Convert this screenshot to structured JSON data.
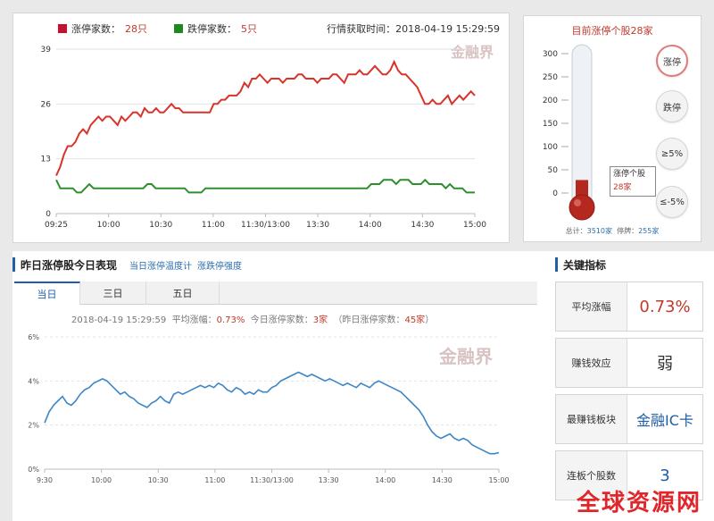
{
  "top_panel": {
    "legend_limit_up_label": "涨停家数：",
    "legend_limit_up_value": "28只",
    "legend_limit_down_label": "跌停家数：",
    "legend_limit_down_value": "5只",
    "timestamp": "行情获取时间：2018-04-19 15:29:59",
    "watermark": "金融界"
  },
  "thermometer": {
    "title": "目前涨停个股28家",
    "tooltip_line1": "涨停个股",
    "tooltip_line2": "28家",
    "footer_total_label": "总计：",
    "footer_total_value": "3510家",
    "footer_suspended_label": "停牌：",
    "footer_suspended_value": "255家",
    "buttons": [
      "涨停",
      "跌停",
      "≥5%",
      "≤-5%"
    ],
    "active_button": "涨停",
    "current_value": 28
  },
  "bottom_section": {
    "title": "昨日涨停股今日表现",
    "link1": "当日涨停温度计",
    "link2": "涨跌停强度",
    "tabs": [
      "当日",
      "三日",
      "五日"
    ],
    "active_tab": "当日",
    "stats_time": "2018-04-19 15:29:59",
    "stats_avg_label": "平均涨幅：",
    "stats_avg_value": "0.73%",
    "stats_today_label": "今日涨停家数：",
    "stats_today_value": "3家",
    "stats_yesterday_label": "（昨日涨停家数：",
    "stats_yesterday_value": "45家",
    "stats_close": "）",
    "watermark": "金融界"
  },
  "key_indicators": {
    "title": "关键指标",
    "items": [
      {
        "label": "平均涨幅",
        "value": "0.73%"
      },
      {
        "label": "赚钱效应",
        "value": "弱"
      },
      {
        "label": "最赚钱板块",
        "value": "金融IC卡"
      },
      {
        "label": "连板个股数",
        "value": "3"
      }
    ]
  },
  "site_watermark": "全球资源网",
  "colors": {
    "up": "#d9342b",
    "down": "#2f8f2f",
    "line": "#3d86c6",
    "accent": "#1f5fa8"
  },
  "chart_data": [
    {
      "type": "line",
      "x_ticks": [
        "09:25",
        "10:00",
        "10:30",
        "11:00",
        "11:30/13:00",
        "13:30",
        "14:00",
        "14:30",
        "15:00"
      ],
      "y_ticks": [
        "0",
        "13",
        "26",
        "39"
      ],
      "ylim": [
        0,
        39
      ],
      "grid": true,
      "series": [
        {
          "name": "涨停家数",
          "color": "#d9342b",
          "values": [
            9,
            11,
            14,
            16,
            16,
            17,
            19,
            20,
            19,
            21,
            22,
            23,
            22,
            23,
            23,
            22,
            21,
            23,
            22,
            23,
            24,
            24,
            23,
            25,
            24,
            24,
            25,
            24,
            24,
            25,
            26,
            25,
            25,
            24,
            24,
            24,
            24,
            24,
            24,
            24,
            24,
            26,
            26,
            27,
            27,
            28,
            28,
            28,
            29,
            31,
            30,
            32,
            32,
            33,
            32,
            31,
            32,
            32,
            32,
            31,
            32,
            32,
            32,
            33,
            33,
            32,
            32,
            32,
            31,
            32,
            32,
            32,
            33,
            33,
            32,
            31,
            33,
            33,
            33,
            34,
            33,
            33,
            34,
            35,
            34,
            33,
            33,
            34,
            36,
            34,
            33,
            33,
            32,
            31,
            30,
            28,
            26,
            26,
            27,
            26,
            26,
            27,
            28,
            26,
            27,
            28,
            27,
            28,
            29,
            28
          ]
        },
        {
          "name": "跌停家数",
          "color": "#2f8f2f",
          "values": [
            8,
            6,
            6,
            6,
            6,
            5,
            5,
            6,
            7,
            6,
            6,
            6,
            6,
            6,
            6,
            6,
            6,
            6,
            6,
            6,
            6,
            6,
            7,
            7,
            6,
            6,
            6,
            6,
            6,
            6,
            6,
            6,
            5,
            5,
            5,
            5,
            6,
            6,
            6,
            6,
            6,
            6,
            6,
            6,
            6,
            6,
            6,
            6,
            6,
            6,
            6,
            6,
            6,
            6,
            6,
            6,
            6,
            6,
            6,
            6,
            6,
            6,
            6,
            6,
            6,
            6,
            6,
            6,
            6,
            6,
            6,
            6,
            6,
            6,
            6,
            6,
            7,
            7,
            7,
            8,
            8,
            8,
            7,
            8,
            8,
            8,
            7,
            7,
            7,
            8,
            7,
            7,
            7,
            7,
            6,
            7,
            6,
            6,
            6,
            5,
            5,
            5
          ]
        }
      ]
    },
    {
      "type": "bar",
      "subtype": "thermometer",
      "y_ticks": [
        "0",
        "50",
        "100",
        "150",
        "200",
        "250",
        "300"
      ],
      "ylim": [
        0,
        300
      ],
      "values": [
        28
      ]
    },
    {
      "type": "line",
      "x_ticks": [
        "9:30",
        "10:00",
        "10:30",
        "11:00",
        "11:30/13:00",
        "13:30",
        "14:00",
        "14:30",
        "15:00"
      ],
      "y_ticks": [
        "0%",
        "2%",
        "4%",
        "6%"
      ],
      "ylim": [
        0,
        6
      ],
      "grid": true,
      "series": [
        {
          "color": "#3d86c6",
          "values": [
            2.1,
            2.6,
            2.9,
            3.1,
            3.3,
            3.0,
            2.9,
            3.1,
            3.4,
            3.6,
            3.7,
            3.9,
            4.0,
            4.1,
            4.0,
            3.8,
            3.6,
            3.4,
            3.5,
            3.3,
            3.2,
            3.0,
            2.9,
            2.8,
            3.0,
            3.1,
            3.3,
            3.1,
            3.0,
            3.4,
            3.5,
            3.4,
            3.5,
            3.6,
            3.7,
            3.8,
            3.7,
            3.8,
            3.7,
            3.9,
            3.8,
            3.6,
            3.5,
            3.7,
            3.6,
            3.4,
            3.5,
            3.4,
            3.6,
            3.5,
            3.5,
            3.7,
            3.8,
            4.0,
            4.1,
            4.2,
            4.3,
            4.4,
            4.3,
            4.2,
            4.3,
            4.2,
            4.1,
            4.0,
            4.1,
            4.0,
            3.9,
            3.8,
            3.9,
            3.8,
            3.7,
            3.9,
            3.8,
            3.7,
            3.9,
            4.0,
            3.9,
            3.8,
            3.7,
            3.6,
            3.5,
            3.3,
            3.1,
            2.9,
            2.7,
            2.4,
            2.0,
            1.7,
            1.5,
            1.4,
            1.5,
            1.6,
            1.4,
            1.3,
            1.4,
            1.3,
            1.1,
            1.0,
            0.9,
            0.8,
            0.7,
            0.7,
            0.75
          ]
        }
      ]
    }
  ]
}
